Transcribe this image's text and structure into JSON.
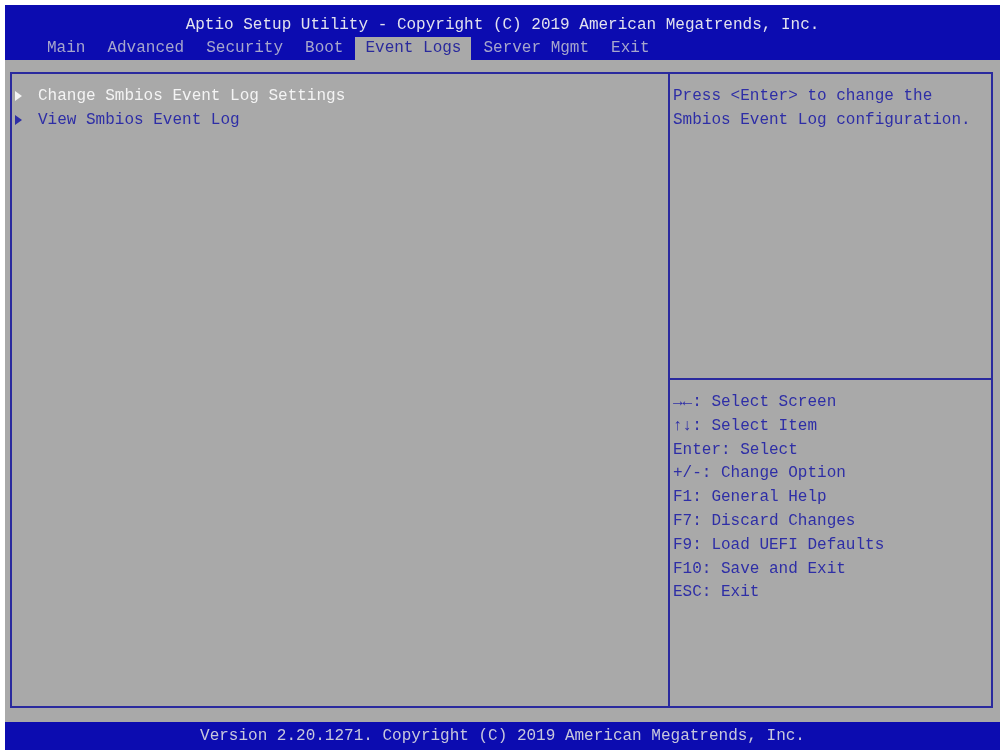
{
  "header": {
    "title": "Aptio Setup Utility - Copyright (C) 2019 American Megatrends, Inc."
  },
  "tabs": [
    {
      "label": "Main",
      "selected": false
    },
    {
      "label": "Advanced",
      "selected": false
    },
    {
      "label": "Security",
      "selected": false
    },
    {
      "label": "Boot",
      "selected": false
    },
    {
      "label": "Event Logs",
      "selected": true
    },
    {
      "label": "Server Mgmt",
      "selected": false
    },
    {
      "label": "Exit",
      "selected": false
    }
  ],
  "menu": {
    "items": [
      {
        "label": "Change Smbios Event Log Settings",
        "selected": true
      },
      {
        "label": "View Smbios Event Log",
        "selected": false
      }
    ]
  },
  "help": {
    "text": "Press <Enter> to change the Smbios Event Log configuration."
  },
  "key_help": [
    "→←: Select Screen",
    "↑↓: Select Item",
    "Enter: Select",
    "+/-: Change Option",
    "F1: General Help",
    "F7: Discard Changes",
    "F9: Load UEFI Defaults",
    "F10: Save and Exit",
    "ESC: Exit"
  ],
  "footer": {
    "text": "Version 2.20.1271. Copyright (C) 2019 American Megatrends, Inc."
  }
}
